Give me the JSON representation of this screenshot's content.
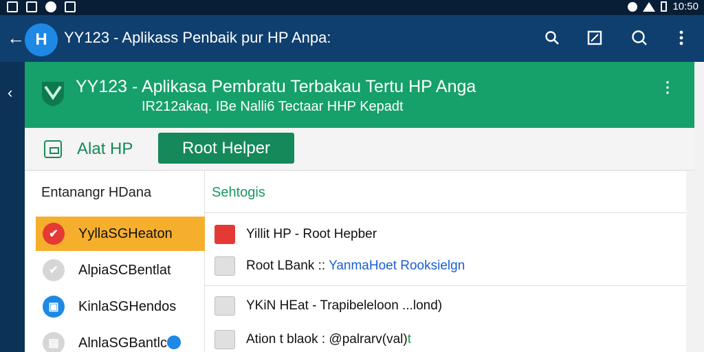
{
  "status_bar": {
    "time": "10:50"
  },
  "app_bar": {
    "logo_text": "H",
    "title": "YY123 - Aplikass Penbaik pur HP Anpa:"
  },
  "banner": {
    "title": "YY123 - Aplikasa Pembratu Terbakau Tertu HP Anga",
    "subtitle": "IR212akaq. IBe Nalli6 Tectaar HHP Kepadt"
  },
  "toolbar": {
    "tool_label": "Alat HP",
    "root_button": "Root Helper"
  },
  "left_list": {
    "header": "Entanangr HDana",
    "items": [
      {
        "label": "YyllaSGHeaton",
        "selected": true,
        "icon_color": "#e53935"
      },
      {
        "label": "AlpiaSCBentlat",
        "selected": false,
        "icon_color": "#d6d6d6"
      },
      {
        "label": "KinlaSGHendos",
        "selected": false,
        "icon_color": "#1e88e5"
      },
      {
        "label": "AlnlaSGBantlc",
        "selected": false,
        "icon_color": "#d6d6d6"
      }
    ]
  },
  "right_list": {
    "header": "Sehtogis",
    "items": [
      {
        "text": "Yillit HP - Root Hepber",
        "extra": ""
      },
      {
        "text": "Root LBank :: ",
        "extra": "YanmaHoet Rooksielgn"
      },
      {
        "text": "YKiN HEat - Trapibeleloon ...lond)",
        "extra": ""
      },
      {
        "text": "Ation t blaok : @palrarv(val)",
        "extra": "t"
      }
    ]
  },
  "colors": {
    "app_bar": "#0f3f6e",
    "banner": "#16a06a",
    "accent_green": "#15895a",
    "selected_item": "#f6ae2d"
  }
}
